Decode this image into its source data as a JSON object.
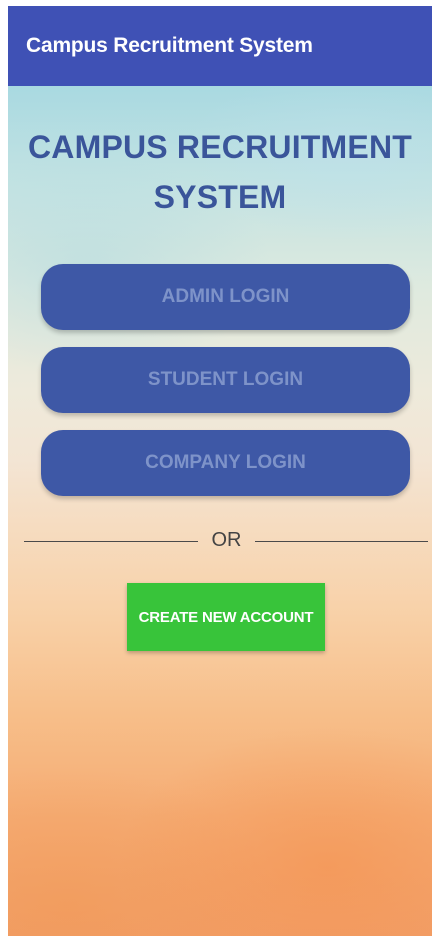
{
  "app_bar": {
    "title": "Campus Recruitment System",
    "color": "#3f51b5"
  },
  "main": {
    "heading_line1": "CAMPUS RECRUITMENT",
    "heading_line2": "SYSTEM",
    "heading_color": "#3a559a",
    "login_buttons": [
      {
        "label": "ADMIN LOGIN"
      },
      {
        "label": "STUDENT LOGIN"
      },
      {
        "label": "COMPANY LOGIN"
      }
    ],
    "login_button_color": "#3e58a6",
    "divider_text": "OR",
    "create_account_label": "CREATE NEW ACCOUNT",
    "create_account_color": "#38c43a"
  }
}
